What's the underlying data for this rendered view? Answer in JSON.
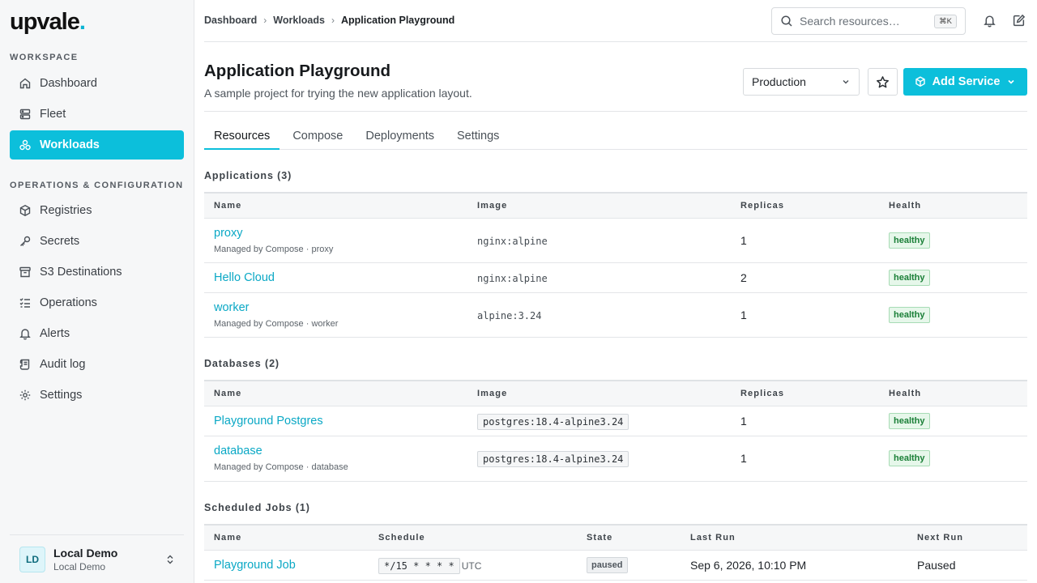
{
  "sidebar": {
    "logo": "upvale",
    "logo_dot": ".",
    "workspace_label": "Workspace",
    "workspace_items": [
      {
        "label": "Dashboard",
        "icon": "home-icon"
      },
      {
        "label": "Fleet",
        "icon": "server-icon"
      },
      {
        "label": "Workloads",
        "icon": "cluster-icon",
        "active": true
      }
    ],
    "ops_label": "Operations & Configuration",
    "ops_items": [
      {
        "label": "Registries",
        "icon": "box-icon"
      },
      {
        "label": "Secrets",
        "icon": "key-icon"
      },
      {
        "label": "S3 Destinations",
        "icon": "archive-icon"
      },
      {
        "label": "Operations",
        "icon": "list-check-icon"
      },
      {
        "label": "Alerts",
        "icon": "bell-icon"
      },
      {
        "label": "Audit log",
        "icon": "scroll-icon"
      },
      {
        "label": "Settings",
        "icon": "gear-icon"
      }
    ],
    "user": {
      "initials": "LD",
      "name": "Local Demo",
      "org": "Local Demo"
    }
  },
  "topbar": {
    "breadcrumb": [
      "Dashboard",
      "Workloads",
      "Application Playground"
    ],
    "search_placeholder": "Search resources…",
    "search_shortcut": "⌘K"
  },
  "header": {
    "title": "Application Playground",
    "subtitle": "A sample project for trying the new application layout.",
    "environment": "Production",
    "add_label": "Add Service"
  },
  "tabs": [
    "Resources",
    "Compose",
    "Deployments",
    "Settings"
  ],
  "applications": {
    "title": "Applications (3)",
    "columns": [
      "Name",
      "Image",
      "Replicas",
      "Health"
    ],
    "rows": [
      {
        "name": "proxy",
        "sub": "Managed by Compose · proxy",
        "image": "nginx:alpine",
        "replicas": "1",
        "health": "healthy"
      },
      {
        "name": "Hello Cloud",
        "sub": "",
        "image": "nginx:alpine",
        "replicas": "2",
        "health": "healthy"
      },
      {
        "name": "worker",
        "sub": "Managed by Compose · worker",
        "image": "alpine:3.24",
        "replicas": "1",
        "health": "healthy"
      }
    ]
  },
  "databases": {
    "title": "Databases (2)",
    "columns": [
      "Name",
      "Image",
      "Replicas",
      "Health"
    ],
    "rows": [
      {
        "name": "Playground Postgres",
        "sub": "",
        "image": "postgres:18.4-alpine3.24",
        "replicas": "1",
        "health": "healthy"
      },
      {
        "name": "database",
        "sub": "Managed by Compose · database",
        "image": "postgres:18.4-alpine3.24",
        "replicas": "1",
        "health": "healthy"
      }
    ]
  },
  "jobs": {
    "title": "Scheduled Jobs (1)",
    "columns": [
      "Name",
      "Schedule",
      "State",
      "Last Run",
      "Next Run"
    ],
    "rows": [
      {
        "name": "Playground Job",
        "schedule": "*/15 * * * *",
        "tz": "UTC",
        "state": "paused",
        "last_run": "Sep 6, 2026, 10:10 PM",
        "next_run": "Paused"
      }
    ]
  }
}
